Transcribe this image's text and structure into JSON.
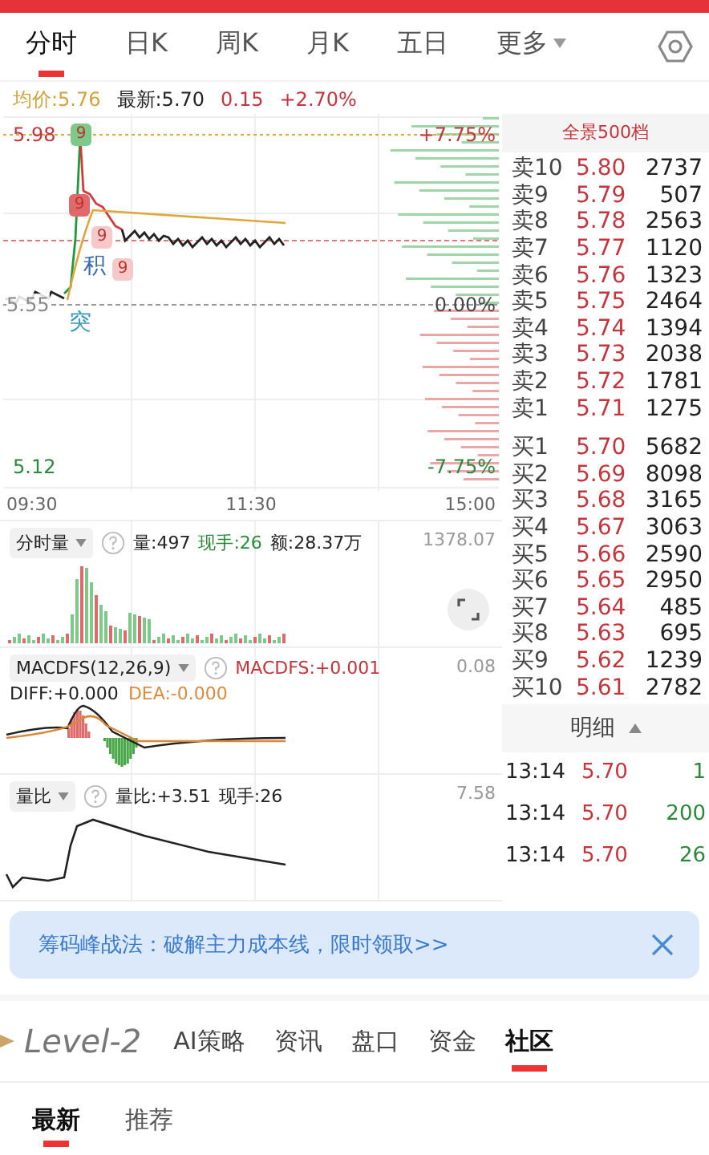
{
  "top_tabs": [
    {
      "label": "分时",
      "selected": true,
      "dropdown": false
    },
    {
      "label": "日K",
      "selected": false,
      "dropdown": false
    },
    {
      "label": "周K",
      "selected": false,
      "dropdown": false
    },
    {
      "label": "月K",
      "selected": false,
      "dropdown": false
    },
    {
      "label": "五日",
      "selected": false,
      "dropdown": false
    },
    {
      "label": "更多",
      "selected": false,
      "dropdown": true
    }
  ],
  "quote_bar": {
    "avg": "均价:5.76",
    "latest": "最新:5.70",
    "change": "0.15",
    "percent": "+2.70%"
  },
  "price_chart": {
    "high": "5.98",
    "base": "5.55",
    "low": "5.12",
    "pct_high": "+7.75%",
    "pct_zero": "0.00%",
    "pct_low": "-7.75%",
    "signals": [
      "积",
      "突"
    ],
    "badges": [
      {
        "label": "9",
        "color": "#7cc98a"
      },
      {
        "label": "9",
        "color": "#e06a6a"
      },
      {
        "label": "9",
        "color": "#f6c9c9"
      },
      {
        "label": "9",
        "color": "#f6c9c9"
      }
    ],
    "times": [
      "09:30",
      "11:30",
      "15:00"
    ]
  },
  "volume_panel": {
    "label": "分时量",
    "volume": "量:497",
    "hand": "现手:26",
    "amount": "额:28.37万",
    "max": "1378.07"
  },
  "macd_panel": {
    "label": "MACDFS(12,26,9)",
    "macdfs": "MACDFS:+0.001",
    "max": "0.08",
    "diff": "DIFF:+0.000",
    "dea": "DEA:-0.000"
  },
  "ratio_panel": {
    "label": "量比",
    "ratio": "量比:+3.51",
    "hand": "现手:26",
    "max": "7.58"
  },
  "order_book": {
    "title": "全景500档",
    "asks": [
      {
        "label": "卖10",
        "price": "5.80",
        "qty": "2737"
      },
      {
        "label": "卖9",
        "price": "5.79",
        "qty": "507"
      },
      {
        "label": "卖8",
        "price": "5.78",
        "qty": "2563"
      },
      {
        "label": "卖7",
        "price": "5.77",
        "qty": "1120"
      },
      {
        "label": "卖6",
        "price": "5.76",
        "qty": "1323"
      },
      {
        "label": "卖5",
        "price": "5.75",
        "qty": "2464"
      },
      {
        "label": "卖4",
        "price": "5.74",
        "qty": "1394"
      },
      {
        "label": "卖3",
        "price": "5.73",
        "qty": "2038"
      },
      {
        "label": "卖2",
        "price": "5.72",
        "qty": "1781"
      },
      {
        "label": "卖1",
        "price": "5.71",
        "qty": "1275"
      }
    ],
    "bids": [
      {
        "label": "买1",
        "price": "5.70",
        "qty": "5682"
      },
      {
        "label": "买2",
        "price": "5.69",
        "qty": "8098"
      },
      {
        "label": "买3",
        "price": "5.68",
        "qty": "3165"
      },
      {
        "label": "买4",
        "price": "5.67",
        "qty": "3063"
      },
      {
        "label": "买5",
        "price": "5.66",
        "qty": "2590"
      },
      {
        "label": "买6",
        "price": "5.65",
        "qty": "2950"
      },
      {
        "label": "买7",
        "price": "5.64",
        "qty": "485"
      },
      {
        "label": "买8",
        "price": "5.63",
        "qty": "695"
      },
      {
        "label": "买9",
        "price": "5.62",
        "qty": "1239"
      },
      {
        "label": "买10",
        "price": "5.61",
        "qty": "2782"
      }
    ]
  },
  "details": {
    "title": "明细",
    "rows": [
      {
        "time": "13:14",
        "price": "5.70",
        "qty": "1"
      },
      {
        "time": "13:14",
        "price": "5.70",
        "qty": "200"
      },
      {
        "time": "13:14",
        "price": "5.70",
        "qty": "26"
      }
    ]
  },
  "banner": {
    "text": "筹码峰战法：破解主力成本线，限时领取>>"
  },
  "section_tabs": {
    "logo": "Level-2",
    "tabs": [
      {
        "label": "AI策略",
        "selected": false
      },
      {
        "label": "资讯",
        "selected": false
      },
      {
        "label": "盘口",
        "selected": false
      },
      {
        "label": "资金",
        "selected": false
      },
      {
        "label": "社区",
        "selected": true
      }
    ]
  },
  "sub_tabs": [
    {
      "label": "最新",
      "selected": true
    },
    {
      "label": "推荐",
      "selected": false
    }
  ]
}
